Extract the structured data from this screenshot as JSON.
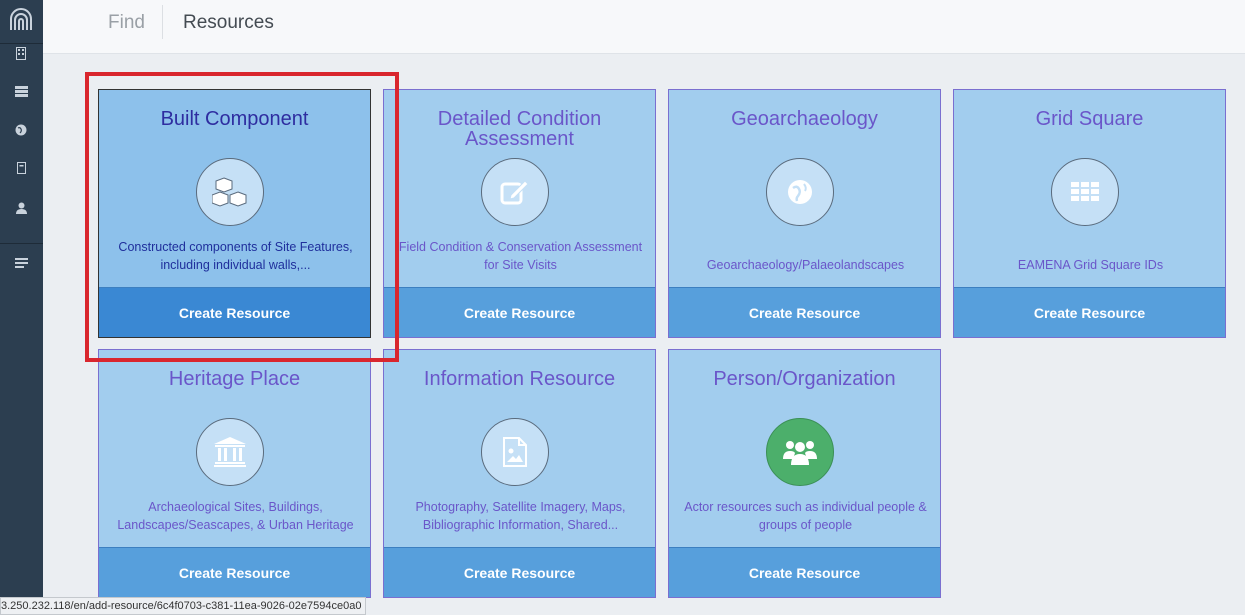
{
  "sidebar": {
    "icons": [
      "logo-icon",
      "building-icon",
      "list-icon",
      "globe-icon",
      "bookmark-icon",
      "user-icon",
      "menu-icon"
    ]
  },
  "topbar": {
    "find_label": "Find",
    "resources_label": "Resources"
  },
  "cards": [
    {
      "title": "Built Component",
      "icon": "cubes-icon",
      "description": "Constructed components of Site Features, including individual walls,...",
      "button": "Create Resource"
    },
    {
      "title": "Detailed Condition Assessment",
      "icon": "edit-icon",
      "description": "Field Condition & Conservation Assessment for Site Visits",
      "button": "Create Resource"
    },
    {
      "title": "Geoarchaeology",
      "icon": "globe-icon",
      "description": "Geoarchaeology/Palaeolandscapes",
      "button": "Create Resource"
    },
    {
      "title": "Grid Square",
      "icon": "grid-icon",
      "description": "EAMENA Grid Square IDs",
      "button": "Create Resource"
    },
    {
      "title": "Heritage Place",
      "icon": "institution-icon",
      "description": "Archaeological Sites, Buildings, Landscapes/Seascapes, & Urban Heritage",
      "button": "Create Resource"
    },
    {
      "title": "Information Resource",
      "icon": "image-file-icon",
      "description": "Photography, Satellite Imagery, Maps, Bibliographic Information, Shared...",
      "button": "Create Resource"
    },
    {
      "title": "Person/Organization",
      "icon": "users-icon",
      "description": "Actor resources such as individual people & groups of people",
      "button": "Create Resource"
    }
  ],
  "status_url": "3.250.232.118/en/add-resource/6c4f0703-c381-11ea-9026-02e7594ce0a0",
  "colors": {
    "sidebar": "#2c3e50",
    "card_bg": "#a2cdee",
    "button": "#579fdc",
    "highlight": "#d9262e",
    "green_icon": "#4caf6b"
  }
}
